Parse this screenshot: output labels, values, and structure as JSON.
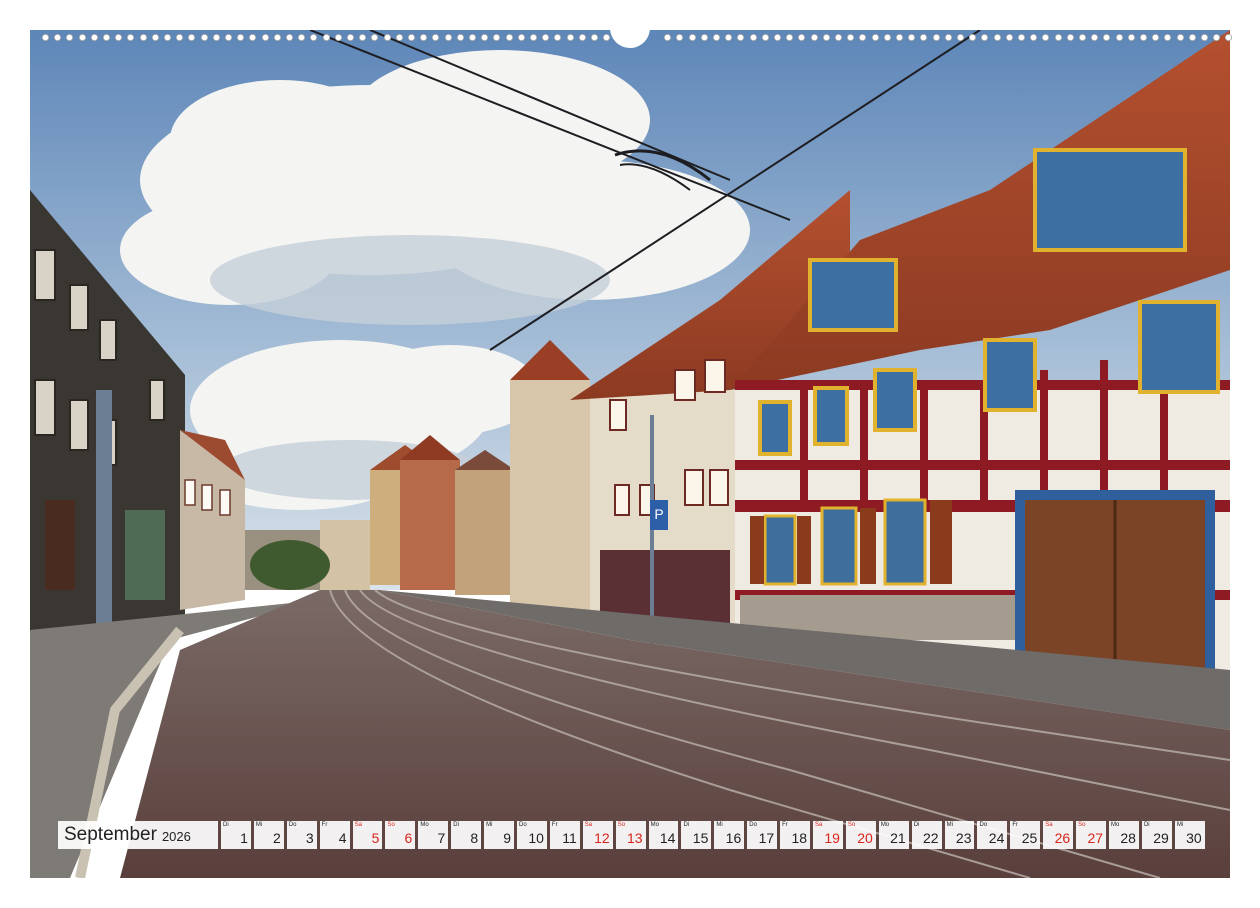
{
  "calendar": {
    "month": "September",
    "year": "2026",
    "weekend_color": "#d9251c",
    "days": [
      {
        "wd": "Di",
        "d": "1",
        "weekend": false
      },
      {
        "wd": "Mi",
        "d": "2",
        "weekend": false
      },
      {
        "wd": "Do",
        "d": "3",
        "weekend": false
      },
      {
        "wd": "Fr",
        "d": "4",
        "weekend": false
      },
      {
        "wd": "Sa",
        "d": "5",
        "weekend": true
      },
      {
        "wd": "So",
        "d": "6",
        "weekend": true
      },
      {
        "wd": "Mo",
        "d": "7",
        "weekend": false
      },
      {
        "wd": "Di",
        "d": "8",
        "weekend": false
      },
      {
        "wd": "Mi",
        "d": "9",
        "weekend": false
      },
      {
        "wd": "Do",
        "d": "10",
        "weekend": false
      },
      {
        "wd": "Fr",
        "d": "11",
        "weekend": false
      },
      {
        "wd": "Sa",
        "d": "12",
        "weekend": true
      },
      {
        "wd": "So",
        "d": "13",
        "weekend": true
      },
      {
        "wd": "Mo",
        "d": "14",
        "weekend": false
      },
      {
        "wd": "Di",
        "d": "15",
        "weekend": false
      },
      {
        "wd": "Mi",
        "d": "16",
        "weekend": false
      },
      {
        "wd": "Do",
        "d": "17",
        "weekend": false
      },
      {
        "wd": "Fr",
        "d": "18",
        "weekend": false
      },
      {
        "wd": "Sa",
        "d": "19",
        "weekend": true
      },
      {
        "wd": "So",
        "d": "20",
        "weekend": true
      },
      {
        "wd": "Mo",
        "d": "21",
        "weekend": false
      },
      {
        "wd": "Di",
        "d": "22",
        "weekend": false
      },
      {
        "wd": "Mi",
        "d": "23",
        "weekend": false
      },
      {
        "wd": "Do",
        "d": "24",
        "weekend": false
      },
      {
        "wd": "Fr",
        "d": "25",
        "weekend": false
      },
      {
        "wd": "Sa",
        "d": "26",
        "weekend": true
      },
      {
        "wd": "So",
        "d": "27",
        "weekend": true
      },
      {
        "wd": "Mo",
        "d": "28",
        "weekend": false
      },
      {
        "wd": "Di",
        "d": "29",
        "weekend": false
      },
      {
        "wd": "Mi",
        "d": "30",
        "weekend": false
      }
    ]
  },
  "signs": {
    "parking": "P"
  }
}
